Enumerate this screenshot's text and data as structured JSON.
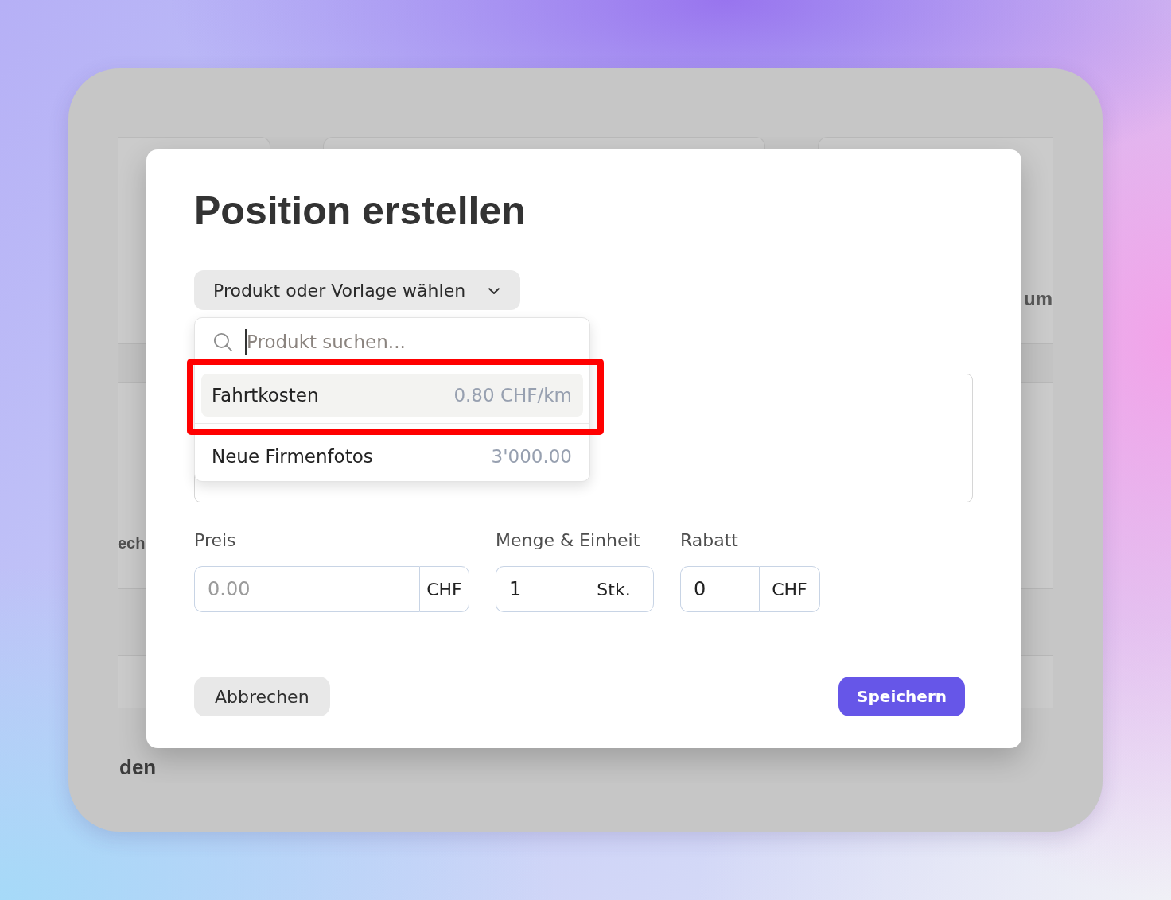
{
  "background_page": {
    "fragments": [
      "um",
      "ech",
      "den"
    ]
  },
  "dialog": {
    "title": "Position erstellen",
    "product_picker": {
      "label": "Produkt oder Vorlage wählen",
      "expanded": true,
      "search": {
        "placeholder": "Produkt suchen..."
      },
      "options": [
        {
          "name": "Fahrtkosten",
          "price": "0.80 CHF/km",
          "selected": true,
          "annotated": true
        },
        {
          "name": "Neue Firmenfotos",
          "price": "3'000.00",
          "selected": false,
          "annotated": false
        }
      ]
    },
    "fields": [
      {
        "label": "Preis",
        "placeholder": "0.00",
        "unit": "CHF"
      },
      {
        "label": "Menge & Einheit",
        "value": "1",
        "unit": "Stk."
      },
      {
        "label": "Rabatt",
        "value": "0",
        "unit": "CHF"
      }
    ],
    "buttons": [
      {
        "label": "Abbrechen",
        "kind": "secondary"
      },
      {
        "label": "Speichern",
        "kind": "primary"
      }
    ]
  }
}
